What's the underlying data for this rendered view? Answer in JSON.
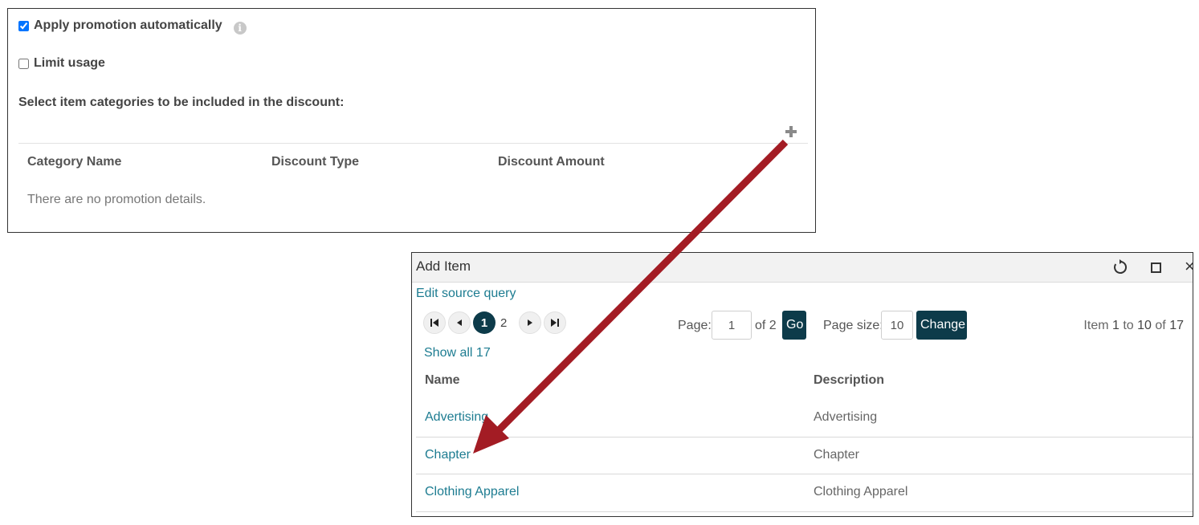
{
  "promotion": {
    "apply_auto_label": "Apply promotion automatically",
    "apply_auto_checked": true,
    "limit_usage_label": "Limit usage",
    "limit_usage_checked": false,
    "info_icon": "info-icon",
    "info_glyph": "i",
    "section_label": "Select item categories to be included in the discount:",
    "add_icon": "plus-icon",
    "table": {
      "headers": [
        "Category Name",
        "Discount Type",
        "Discount Amount"
      ],
      "empty_message": "There are no promotion details."
    }
  },
  "dialog": {
    "title": "Add Item",
    "icons": [
      "refresh-icon",
      "maximize-icon",
      "close-icon"
    ],
    "close_glyph": "×",
    "edit_query_label": "Edit source query",
    "pager": {
      "first_glyph": "⏮",
      "prev_glyph": "◀",
      "next_glyph": "▶",
      "last_glyph": "⏭",
      "current_page": "1",
      "next_page": "2",
      "page_label": "Page:",
      "page_value": "1",
      "of_label": "of 2",
      "go_label": "Go",
      "page_size_label": "Page size:",
      "page_size_value": "10",
      "change_label": "Change",
      "range": {
        "prefix": "Item",
        "start": "1",
        "to": "to",
        "end": "10",
        "of": "of",
        "total": "17"
      }
    },
    "show_all_label": "Show all 17",
    "columns": [
      "Name",
      "Description"
    ],
    "rows": [
      {
        "name": "Advertising",
        "description": "Advertising"
      },
      {
        "name": "Chapter",
        "description": "Chapter"
      },
      {
        "name": "Clothing Apparel",
        "description": "Clothing Apparel"
      }
    ]
  },
  "annotation": {
    "arrow_color": "#a31c24"
  },
  "colors": {
    "link": "#1d7c91",
    "dark_button": "#0d3b4a"
  }
}
